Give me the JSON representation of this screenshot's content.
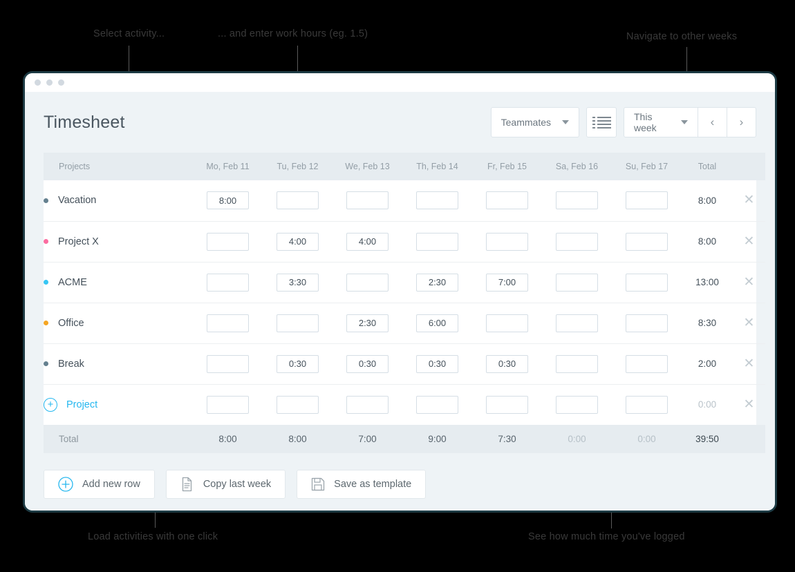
{
  "annotations": [
    {
      "id": "select-activity",
      "text": "Select activity..."
    },
    {
      "id": "enter-hours",
      "text": "... and enter work hours (eg. 1.5)"
    },
    {
      "id": "navigate-weeks",
      "text": "Navigate to other weeks"
    },
    {
      "id": "load-activities",
      "text": "Load activities with one click"
    },
    {
      "id": "time-logged",
      "text": "See how much time you've logged"
    }
  ],
  "header": {
    "title": "Timesheet",
    "teammates_label": "Teammates",
    "list_view_icon": "list-view-icon",
    "week_label": "This week",
    "prev_icon": "chevron-left-icon",
    "next_icon": "chevron-right-icon"
  },
  "table": {
    "columns": [
      "Projects",
      "Mo, Feb 11",
      "Tu, Feb 12",
      "We, Feb 13",
      "Th, Feb 14",
      "Fr, Feb 15",
      "Sa, Feb 16",
      "Su, Feb 17",
      "Total"
    ],
    "rows": [
      {
        "name": "Vacation",
        "color": "#64808f",
        "values": [
          "8:00",
          "",
          "",
          "",
          "",
          "",
          ""
        ],
        "total": "8:00",
        "total_zero": false
      },
      {
        "name": "Project X",
        "color": "#fb6ca0",
        "values": [
          "",
          "4:00",
          "4:00",
          "",
          "",
          "",
          ""
        ],
        "total": "8:00",
        "total_zero": false
      },
      {
        "name": "ACME",
        "color": "#36c6f4",
        "values": [
          "",
          "3:30",
          "",
          "2:30",
          "7:00",
          "",
          ""
        ],
        "total": "13:00",
        "total_zero": false
      },
      {
        "name": "Office",
        "color": "#f5a623",
        "values": [
          "",
          "",
          "2:30",
          "6:00",
          "",
          "",
          ""
        ],
        "total": "8:30",
        "total_zero": false
      },
      {
        "name": "Break",
        "color": "#64808f",
        "values": [
          "",
          "0:30",
          "0:30",
          "0:30",
          "0:30",
          "",
          ""
        ],
        "total": "2:00",
        "total_zero": false
      }
    ],
    "add_row": {
      "label": "Project",
      "icon": "plus-circle-icon",
      "values": [
        "",
        "",
        "",
        "",
        "",
        "",
        ""
      ],
      "total": "0:00"
    },
    "footer": {
      "label": "Total",
      "values": [
        "8:00",
        "8:00",
        "7:00",
        "9:00",
        "7:30",
        "0:00",
        "0:00"
      ],
      "zero_flags": [
        false,
        false,
        false,
        false,
        false,
        true,
        true
      ],
      "grand_total": "39:50"
    },
    "delete_icon": "close-icon",
    "input_placeholder": ""
  },
  "actions": [
    {
      "label": "Add new row",
      "icon": "plus-circle-icon"
    },
    {
      "label": "Copy last week",
      "icon": "copy-document-icon"
    },
    {
      "label": "Save as template",
      "icon": "floppy-save-icon"
    }
  ],
  "window": {
    "dots": [
      "dot-1",
      "dot-2",
      "dot-3"
    ]
  },
  "colors": {
    "accent": "#25b7ef",
    "frame": "#1d3b44",
    "app_bg": "#eef3f6",
    "header_row": "#e6ecf0"
  }
}
